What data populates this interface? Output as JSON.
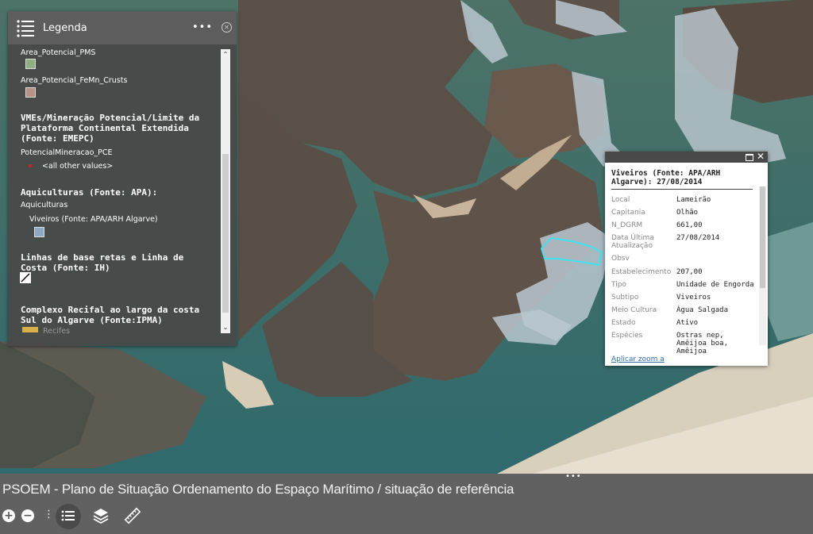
{
  "legend": {
    "title": "Legenda",
    "items": [
      {
        "label": "Area_Potencial_PMS",
        "swatch": "#8fae82"
      },
      {
        "label": "Area_Potencial_FeMn_Crusts",
        "swatch": "#b89287"
      }
    ],
    "section_emepc": {
      "title": "VMEs/Mineração Potencial/Limite da Plataforma Continental Extendida (Fonte: EMEPC)",
      "layer": "PotencialMineracao_PCE",
      "value": "<all other values>",
      "dot_color": "#d21f1f"
    },
    "section_apa": {
      "title": "Aquiculturas (Fonte: APA):",
      "layer": "Aquiculturas",
      "item": "Viveiros (Fonte: APA/ARH Algarve)",
      "swatch": "#8eaac2"
    },
    "section_ih": {
      "title": "Linhas de base retas e Linha de Costa (Fonte: IH)"
    },
    "section_ipma": {
      "title": "Complexo Recifal ao largo da costa Sul do Algarve (Fonte:IPMA)",
      "item": "Recifes",
      "swatch": "#d8b04a"
    }
  },
  "popup": {
    "title": "Viveiros (Fonte: APA/ARH Algarve): 27/08/2014",
    "fields": [
      {
        "key": "Local",
        "value": "Lameirão"
      },
      {
        "key": "Capitania",
        "value": "Olhão"
      },
      {
        "key": "N_DGRM",
        "value": "661,00"
      },
      {
        "key": "Data Última Atualização",
        "value": "27/08/2014"
      },
      {
        "key": "Obsv",
        "value": ""
      },
      {
        "key": "Estabelecimento",
        "value": "207,00"
      },
      {
        "key": "Tipo",
        "value": "Unidade de Engorda"
      },
      {
        "key": "Subtipo",
        "value": "Viveiros"
      },
      {
        "key": "Meio Cultura",
        "value": "Água Salgada"
      },
      {
        "key": "Estado",
        "value": "Ativo"
      },
      {
        "key": "Espécies",
        "value": "Ostras nep, Amêijoa boa, Amêijoa"
      }
    ],
    "zoom_link": "Aplicar zoom a"
  },
  "bottom": {
    "caption": "PSOEM - Plano de Situação Ordenamento do Espaço Marítimo / situação de referência",
    "zoom_in": "+",
    "zoom_out": "−"
  },
  "colors": {
    "panel": "#484848",
    "header": "#5d5d5d",
    "bottom_bar": "#616161",
    "water": "#3f6a5c",
    "highlight": "#3fe3ef"
  },
  "icons": [
    "list-icon",
    "more-icon",
    "close-icon",
    "maximize-icon",
    "zoom-in-icon",
    "zoom-out-icon",
    "legend-icon",
    "layers-icon",
    "measure-icon"
  ]
}
